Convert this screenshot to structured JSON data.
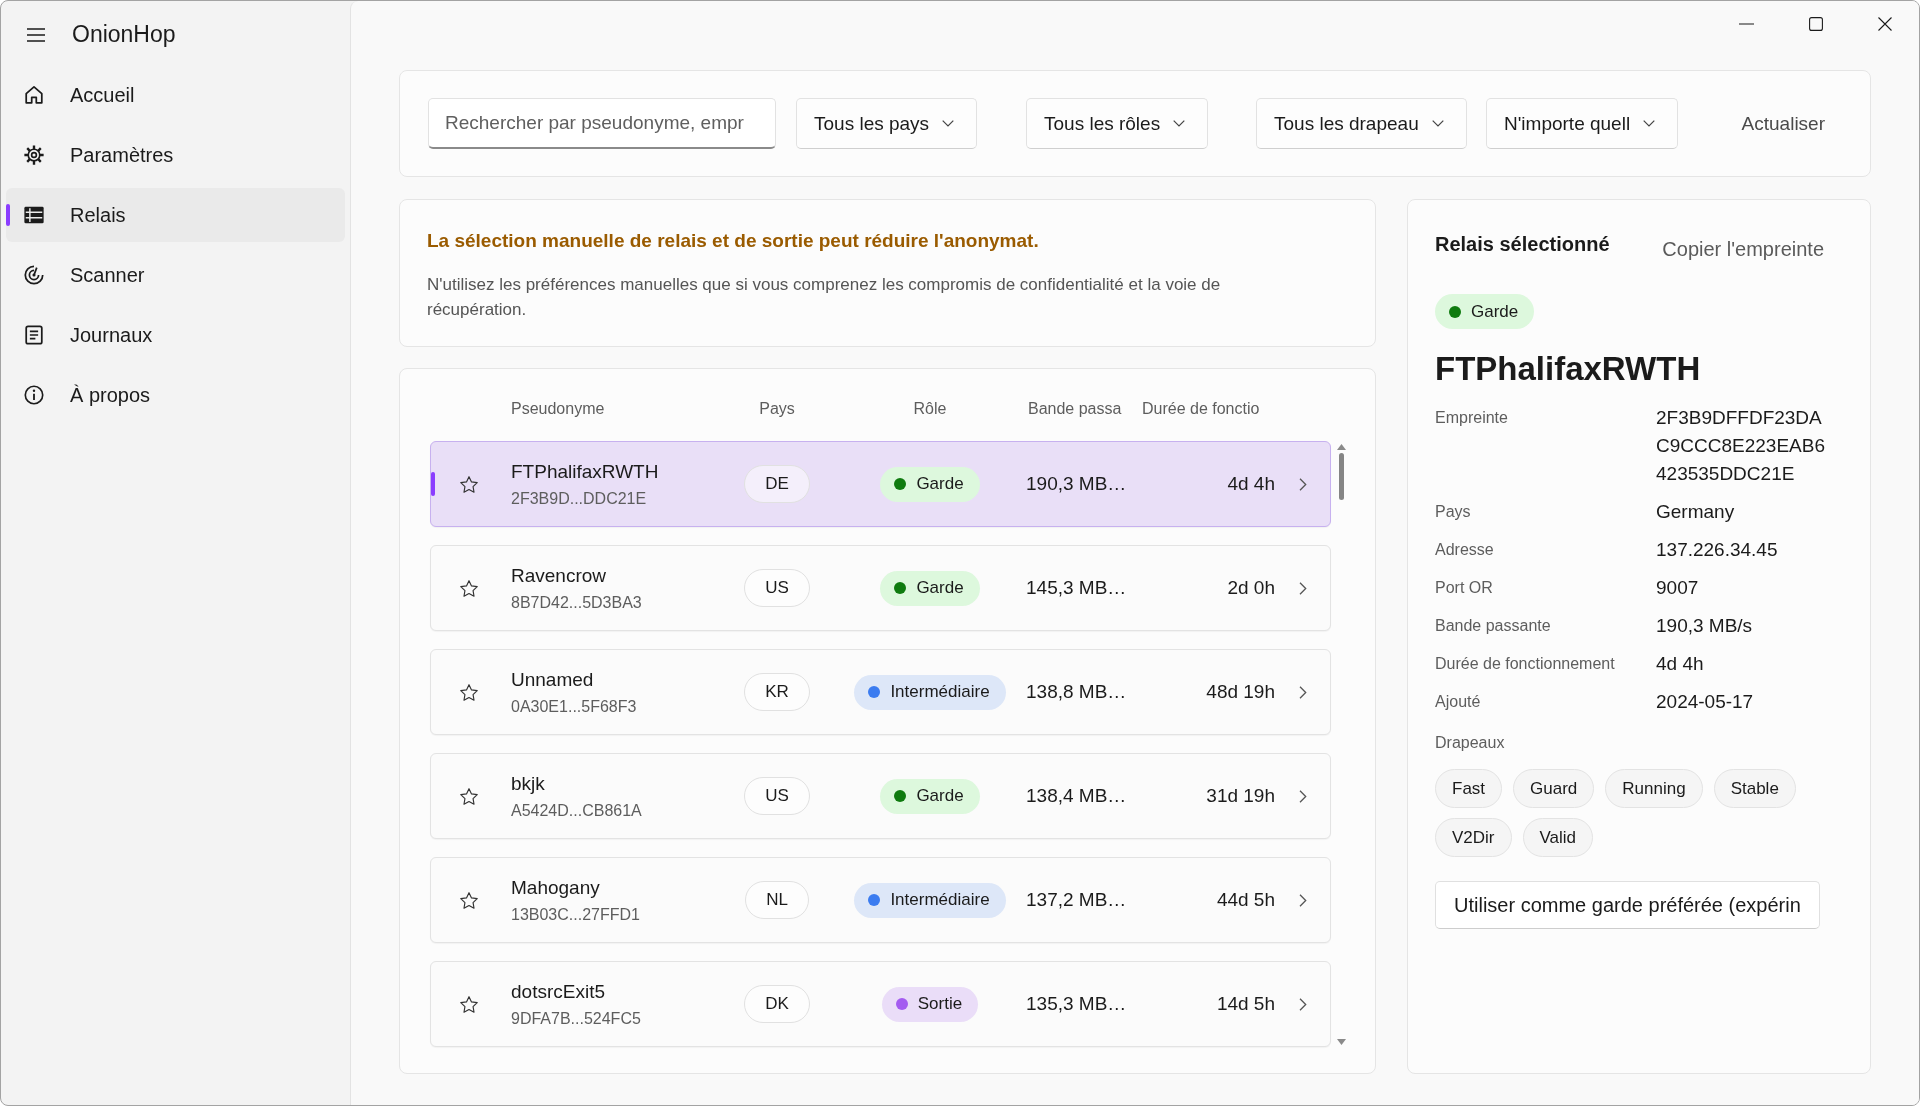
{
  "app": {
    "title": "OnionHop"
  },
  "sidebar": {
    "items": [
      {
        "label": "Accueil",
        "selected": false
      },
      {
        "label": "Paramètres",
        "selected": false
      },
      {
        "label": "Relais",
        "selected": true
      },
      {
        "label": "Scanner",
        "selected": false
      },
      {
        "label": "Journaux",
        "selected": false
      },
      {
        "label": "À propos",
        "selected": false
      }
    ]
  },
  "filters": {
    "search": {
      "placeholder": "Rechercher par pseudonyme, empr"
    },
    "dropdowns": [
      "Tous les pays",
      "Tous les rôles",
      "Tous les drapeau",
      "N'importe quell"
    ],
    "refresh_button": "Actualiser"
  },
  "warning": {
    "title": "La sélection manuelle de relais et de sortie peut réduire l'anonymat.",
    "text": "N'utilisez les préférences manuelles que si vous comprenez les compromis de confidentialité et la voie de récupération."
  },
  "relays": {
    "columns": [
      "Pseudonyme",
      "Pays",
      "Rôle",
      "Bande passa",
      "Durée de fonctio"
    ],
    "rows": [
      {
        "nickname": "FTPhalifaxRWTH",
        "fingerprint": "2F3B9D...DDC21E",
        "country": "DE",
        "role": {
          "label": "Garde",
          "color": "#0f7b0f"
        },
        "bandwidth": "190,3 MB…",
        "uptime": "4d 4h",
        "starred": false,
        "selected": true
      },
      {
        "nickname": "Ravencrow",
        "fingerprint": "8B7D42...5D3BA3",
        "country": "US",
        "role": {
          "label": "Garde",
          "color": "#0f7b0f"
        },
        "bandwidth": "145,3 MB…",
        "uptime": "2d 0h",
        "starred": false,
        "selected": false
      },
      {
        "nickname": "Unnamed",
        "fingerprint": "0A30E1...5F68F3",
        "country": "KR",
        "role": {
          "label": "Intermédiaire",
          "color": "#3b7cf0"
        },
        "bandwidth": "138,8 MB…",
        "uptime": "48d 19h",
        "starred": false,
        "selected": false
      },
      {
        "nickname": "bkjk",
        "fingerprint": "A5424D...CB861A",
        "country": "US",
        "role": {
          "label": "Garde",
          "color": "#0f7b0f"
        },
        "bandwidth": "138,4 MB…",
        "uptime": "31d 19h",
        "starred": false,
        "selected": false
      },
      {
        "nickname": "Mahogany",
        "fingerprint": "13B03C...27FFD1",
        "country": "NL",
        "role": {
          "label": "Intermédiaire",
          "color": "#3b7cf0"
        },
        "bandwidth": "137,2 MB…",
        "uptime": "44d 5h",
        "starred": false,
        "selected": false
      },
      {
        "nickname": "dotsrcExit5",
        "fingerprint": "9DFA7B...524FC5",
        "country": "DK",
        "role": {
          "label": "Sortie",
          "color": "#a45cf0"
        },
        "bandwidth": "135,3 MB…",
        "uptime": "14d 5h",
        "starred": false,
        "selected": false
      }
    ]
  },
  "details": {
    "title": "Relais sélectionné",
    "copy_button": "Copier l'empreinte",
    "role": {
      "label": "Garde",
      "color": "#0f7b0f"
    },
    "nickname": "FTPhalifaxRWTH",
    "fields": [
      {
        "label": "Empreinte",
        "value": "2F3B9DFFDF23DAC9CCC8E223EAB6423535DDC21E"
      },
      {
        "label": "Pays",
        "value": "Germany"
      },
      {
        "label": "Adresse",
        "value": "137.226.34.45"
      },
      {
        "label": "Port OR",
        "value": "9007"
      },
      {
        "label": "Bande passante",
        "value": "190,3 MB/s"
      },
      {
        "label": "Durée de fonctionnement",
        "value": "4d 4h"
      },
      {
        "label": "Ajouté",
        "value": "2024-05-17"
      }
    ],
    "flags_label": "Drapeaux",
    "flags": [
      "Fast",
      "Guard",
      "Running",
      "Stable",
      "V2Dir",
      "Valid"
    ],
    "action_button": "Utiliser comme garde préférée (expérin"
  }
}
